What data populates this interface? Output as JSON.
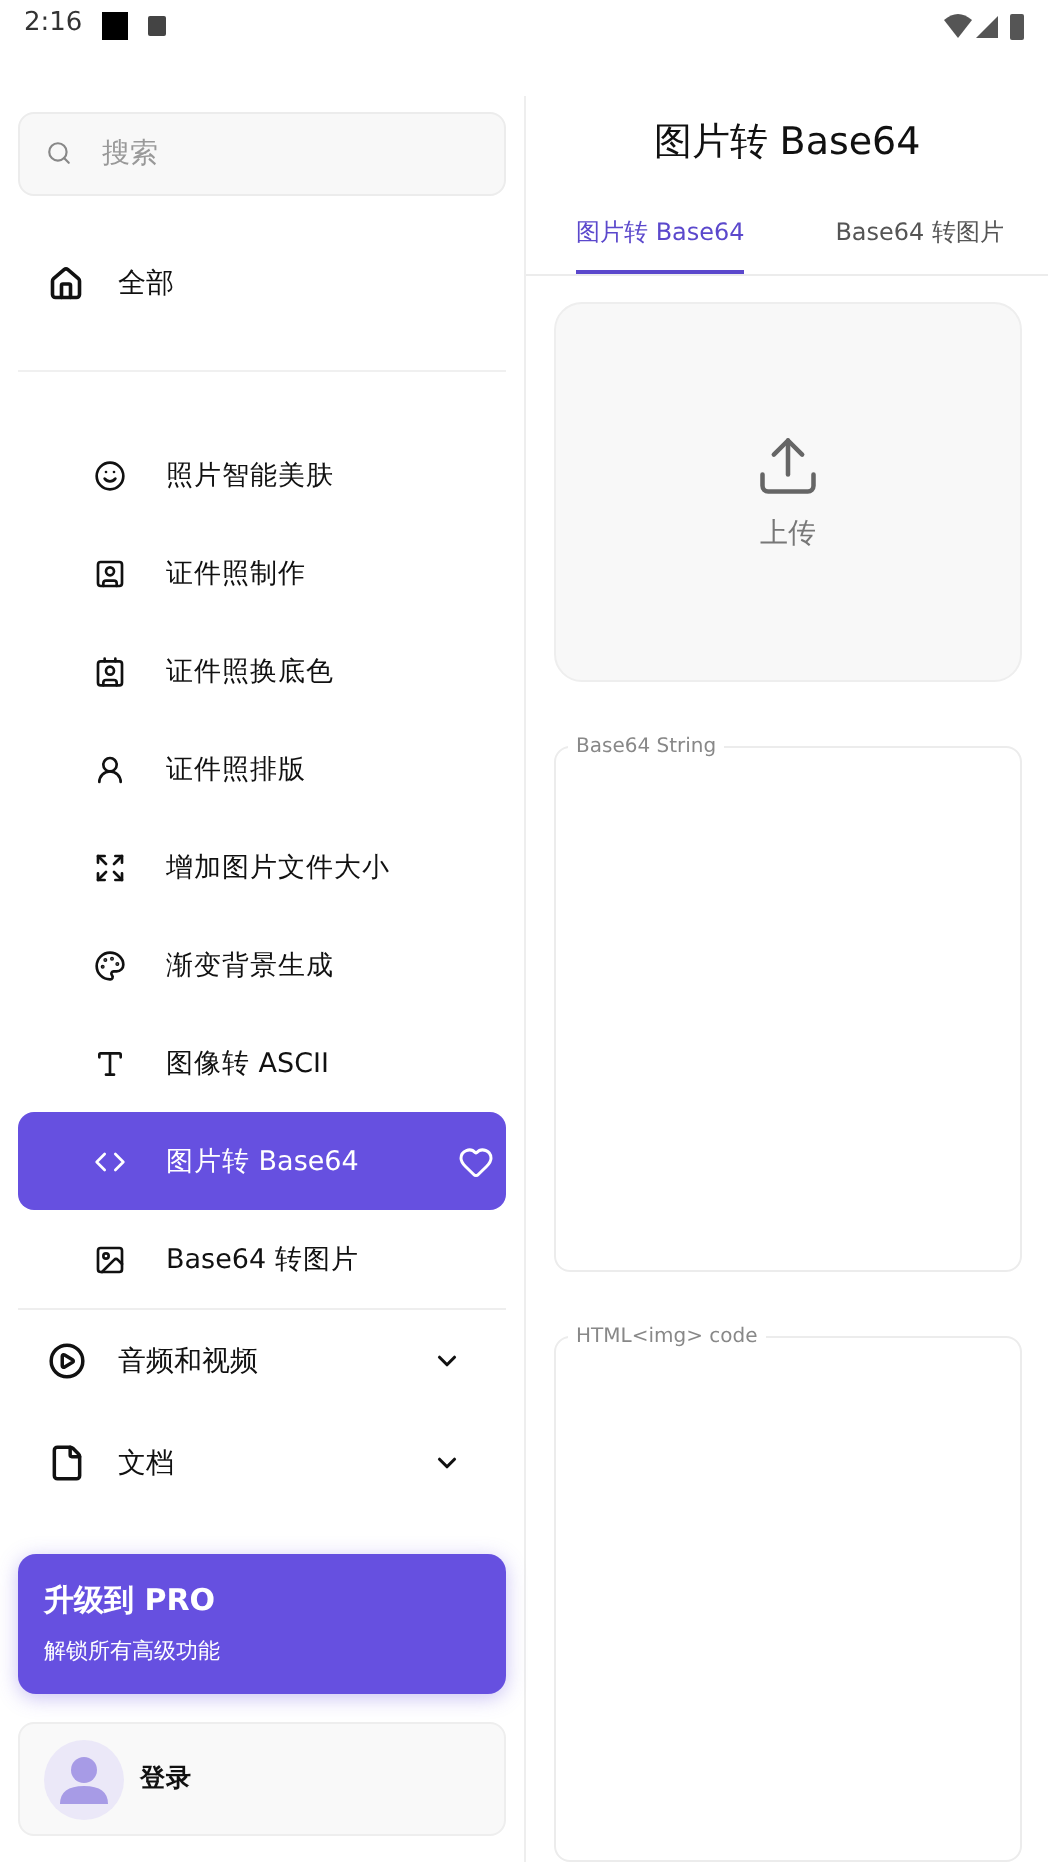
{
  "status_bar": {
    "time": "2:16"
  },
  "sidebar": {
    "search": {
      "placeholder": "搜索"
    },
    "home": {
      "label": "全部"
    },
    "tools": [
      {
        "label": "照片智能美肤",
        "selected": false
      },
      {
        "label": "证件照制作",
        "selected": false
      },
      {
        "label": "证件照换底色",
        "selected": false
      },
      {
        "label": "证件照排版",
        "selected": false
      },
      {
        "label": "增加图片文件大小",
        "selected": false
      },
      {
        "label": "渐变背景生成",
        "selected": false
      },
      {
        "label": "图像转 ASCII",
        "selected": false
      },
      {
        "label": "图片转 Base64",
        "selected": true
      },
      {
        "label": "Base64 转图片",
        "selected": false
      }
    ],
    "groups": [
      {
        "label": "音频和视频",
        "expanded": false
      },
      {
        "label": "文档",
        "expanded": false
      }
    ],
    "upgrade": {
      "title": "升级到 PRO",
      "subtitle": "解锁所有高级功能"
    },
    "account": {
      "label": "登录"
    }
  },
  "main": {
    "title": "图片转 Base64",
    "tabs": [
      {
        "label": "图片转 Base64",
        "selected": true
      },
      {
        "label": "Base64 转图片",
        "selected": false
      }
    ],
    "upload": {
      "label": "上传"
    },
    "fields": [
      {
        "label": "Base64 String"
      },
      {
        "label": "HTML<img> code"
      }
    ]
  }
}
